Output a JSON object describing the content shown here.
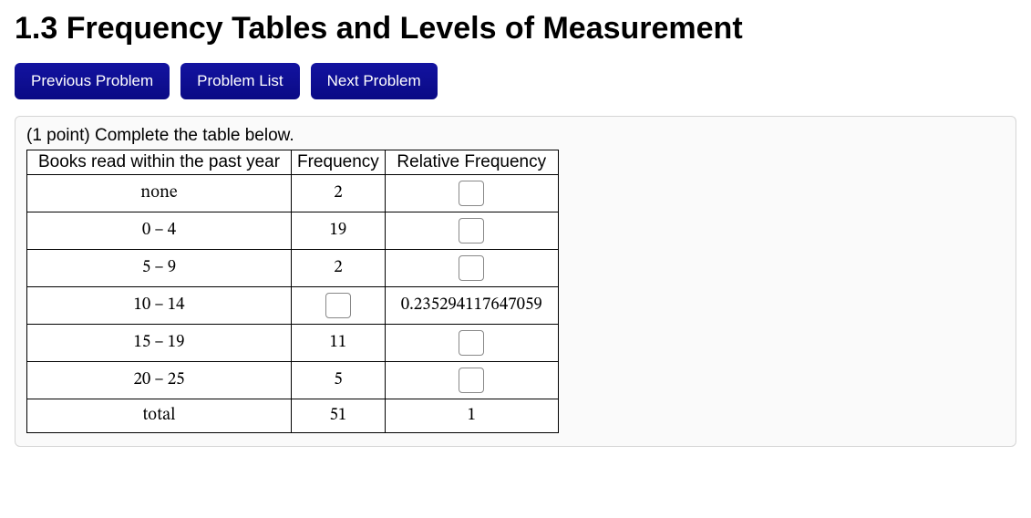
{
  "title": "1.3 Frequency Tables and Levels of Measurement",
  "nav": {
    "prev": "Previous Problem",
    "list": "Problem List",
    "next": "Next Problem"
  },
  "prompt": "(1 point) Complete the table below.",
  "headers": {
    "category": "Books read within the past year",
    "frequency": "Frequency",
    "relative": "Relative Frequency"
  },
  "rows": [
    {
      "category": "none",
      "frequency": "2",
      "relative": ""
    },
    {
      "category": "0 – 4",
      "frequency": "19",
      "relative": ""
    },
    {
      "category": "5 – 9",
      "frequency": "2",
      "relative": ""
    },
    {
      "category": "10 – 14",
      "frequency": "",
      "relative": "0.235294117647059"
    },
    {
      "category": "15 – 19",
      "frequency": "11",
      "relative": ""
    },
    {
      "category": "20 – 25",
      "frequency": "5",
      "relative": ""
    }
  ],
  "total": {
    "label": "total",
    "frequency": "51",
    "relative": "1"
  }
}
